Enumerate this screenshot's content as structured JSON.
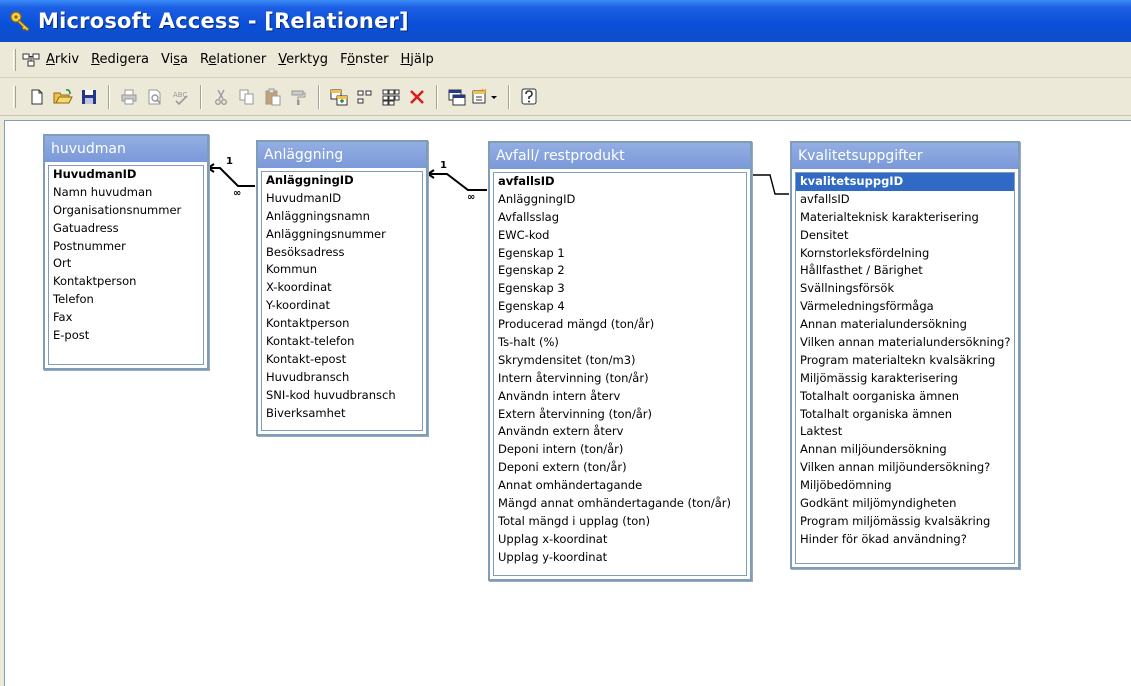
{
  "window": {
    "title": "Microsoft Access - [Relationer]"
  },
  "menu": {
    "items": [
      {
        "pre": "",
        "u": "A",
        "post": "rkiv"
      },
      {
        "pre": "",
        "u": "R",
        "post": "edigera"
      },
      {
        "pre": "Vi",
        "u": "s",
        "post": "a"
      },
      {
        "pre": "R",
        "u": "e",
        "post": "lationer"
      },
      {
        "pre": "",
        "u": "V",
        "post": "erktyg"
      },
      {
        "pre": "F",
        "u": "ö",
        "post": "nster"
      },
      {
        "pre": "",
        "u": "H",
        "post": "jälp"
      }
    ]
  },
  "tables": {
    "huvudman": {
      "title": "huvudman",
      "fields": [
        "HuvudmanID",
        "Namn huvudman",
        "Organisationsnummer",
        "Gatuadress",
        "Postnummer",
        "Ort",
        "Kontaktperson",
        "Telefon",
        "Fax",
        "E-post"
      ]
    },
    "anlaggning": {
      "title": "Anläggning",
      "fields": [
        "AnläggningID",
        "HuvudmanID",
        "Anläggningsnamn",
        "Anläggningsnummer",
        "Besöksadress",
        "Kommun",
        "X-koordinat",
        "Y-koordinat",
        "Kontaktperson",
        "Kontakt-telefon",
        "Kontakt-epost",
        "Huvudbransch",
        "SNI-kod huvudbransch",
        "Biverksamhet"
      ]
    },
    "avfall": {
      "title": "Avfall/ restprodukt",
      "fields": [
        "avfallsID",
        "AnläggningID",
        "Avfallsslag",
        "EWC-kod",
        "Egenskap 1",
        "Egenskap 2",
        "Egenskap 3",
        "Egenskap 4",
        "Producerad mängd (ton/år)",
        "Ts-halt (%)",
        "Skrymdensitet (ton/m3)",
        "Intern återvinning (ton/år)",
        "Användn intern återv",
        "Extern återvinning (ton/år)",
        "Användn extern återv",
        "Deponi intern (ton/år)",
        "Deponi extern (ton/år)",
        "Annat omhändertagande",
        "Mängd annat omhändertagande (ton/år)",
        "Total mängd i upplag (ton)",
        "Upplag x-koordinat",
        "Upplag y-koordinat"
      ]
    },
    "kvalitet": {
      "title": "Kvalitetsuppgifter",
      "fields": [
        "kvalitetsuppgID",
        "avfallsID",
        "Materialteknisk karakterisering",
        "Densitet",
        "Kornstorleksfördelning",
        "Hållfasthet / Bärighet",
        "Svällningsförsök",
        "Värmeledningsförmåga",
        "Annan materialundersökning",
        "Vilken annan materialundersökning?",
        "Program materialtekn kvalsäkring",
        "Miljömässig karakterisering",
        "Totalhalt oorganiska ämnen",
        "Totalhalt organiska ämnen",
        "Laktest",
        "Annan miljöundersökning",
        "Vilken annan miljöundersökning?",
        "Miljöbedömning",
        "Godkänt miljömyndigheten",
        "Program miljömässig kvalsäkring",
        "Hinder för ökad användning?"
      ]
    }
  },
  "relations": [
    {
      "one": "1",
      "many": "∞"
    },
    {
      "one": "1",
      "many": "∞"
    }
  ],
  "icons": {
    "toolbar": [
      "new-icon",
      "open-icon",
      "save-icon",
      "print-icon",
      "print-preview-icon",
      "spelling-icon",
      "cut-icon",
      "copy-icon",
      "paste-icon",
      "format-painter-icon",
      "show-table-icon",
      "show-direct-icon",
      "show-all-icon",
      "delete-icon",
      "new-object-icon",
      "help-icon"
    ]
  },
  "colors": {
    "titlebar": "#0a4fd8",
    "table_header": "#7b99d9",
    "selection": "#316ac5"
  }
}
